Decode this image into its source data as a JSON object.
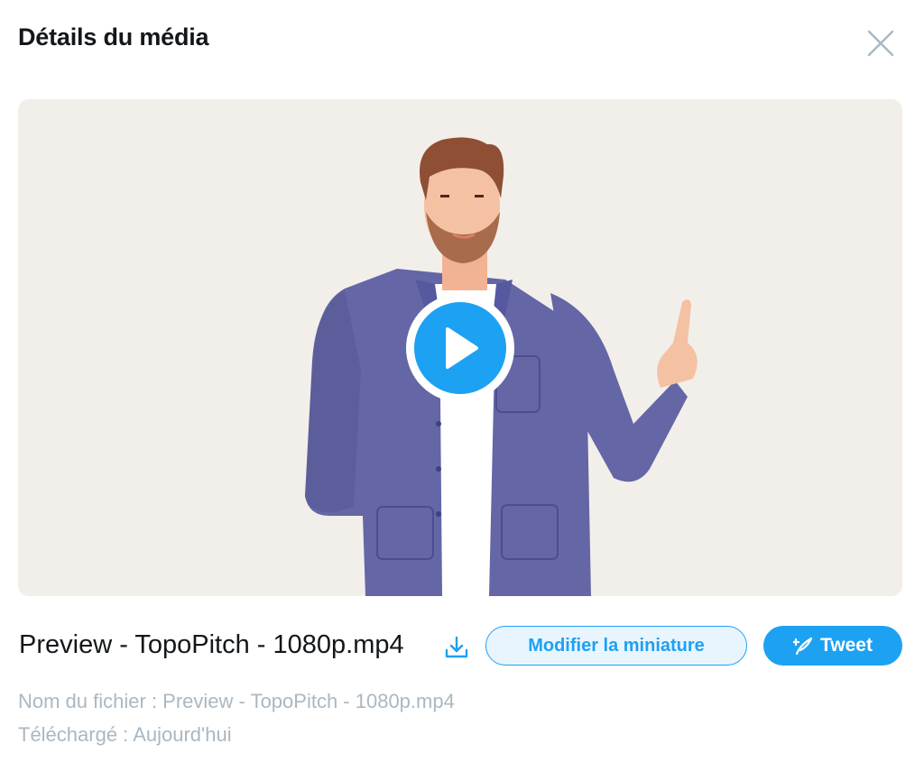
{
  "dialog": {
    "title": "Détails du média"
  },
  "media": {
    "play_icon": "play-icon",
    "close_icon": "close-icon"
  },
  "file": {
    "display_name": "Preview - TopoPitch - 1080p.mp4",
    "download_icon": "download-icon",
    "name_line": "Nom du fichier : Preview - TopoPitch - 1080p.mp4",
    "uploaded_line": "Téléchargé : Aujourd'hui"
  },
  "actions": {
    "edit_thumbnail_label": "Modifier la miniature",
    "tweet_label": "Tweet",
    "tweet_icon": "compose-icon"
  },
  "colors": {
    "accent": "#1da1f2",
    "accent_light": "#e8f5fe",
    "muted_text": "#aab8c2",
    "video_bg": "#f2efea",
    "jacket": "#6466a6"
  }
}
